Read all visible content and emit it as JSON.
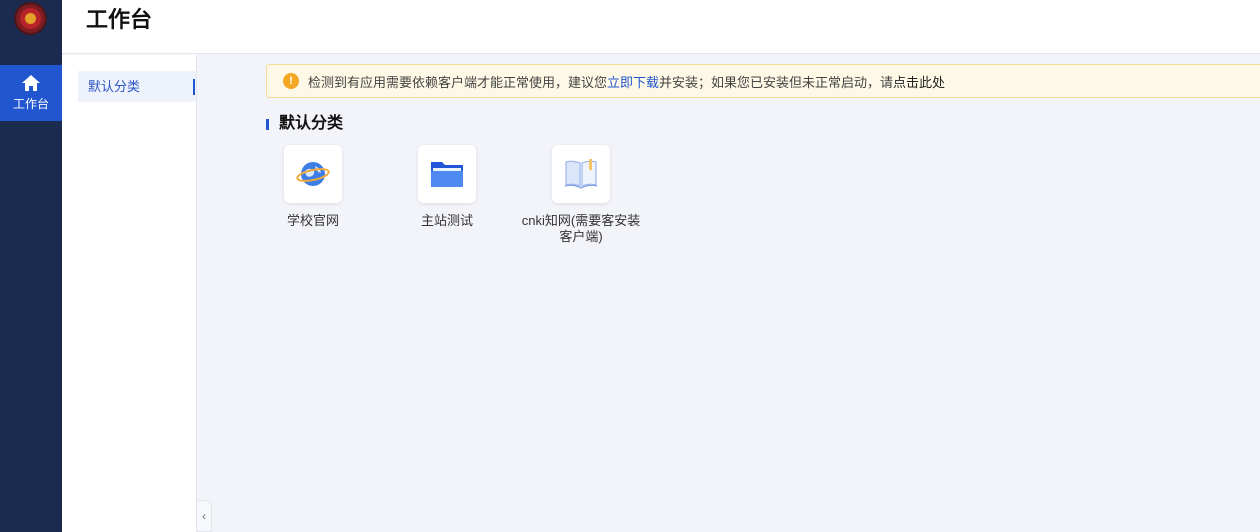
{
  "rail": {
    "workbench_label": "工作台"
  },
  "header": {
    "title": "工作台"
  },
  "categories": {
    "items": [
      {
        "label": "默认分类",
        "selected": true
      }
    ]
  },
  "notice": {
    "text_before": "检测到有应用需要依赖客户端才能正常使用，建议您",
    "download_link": "立即下载",
    "text_middle": "并安装；如果您已安装但未正常启动，请",
    "click_link": "点击此处"
  },
  "section": {
    "title": "默认分类"
  },
  "apps": [
    {
      "name": "学校官网",
      "icon": "globe-icon"
    },
    {
      "name": "主站测试",
      "icon": "folder-icon"
    },
    {
      "name": "cnki知网(需要客安装客户端)",
      "icon": "book-icon"
    }
  ],
  "colors": {
    "rail_bg": "#1b2a4f",
    "accent": "#2156d0",
    "notice_bg": "#fef8e6",
    "warning": "#f5a623"
  }
}
